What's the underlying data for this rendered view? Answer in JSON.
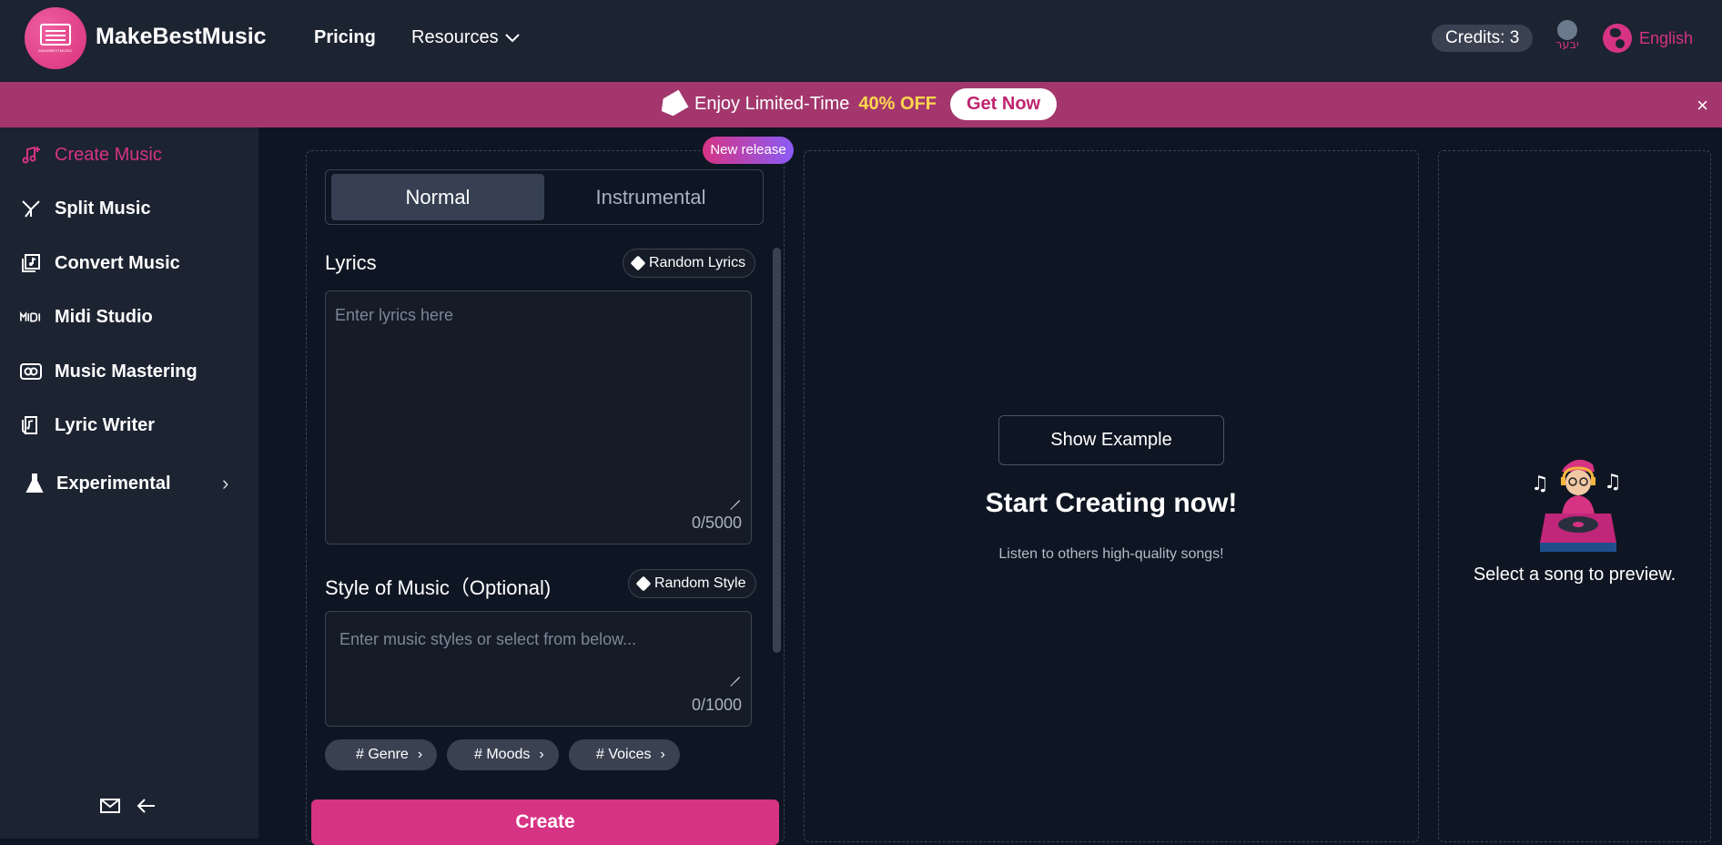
{
  "header": {
    "logo_text": "MAKEBESTMUSIC",
    "brand": "MakeBestMusic",
    "nav": {
      "pricing": "Pricing",
      "resources": "Resources"
    },
    "credits": "Credits: 3",
    "avatar_alt": "יבער",
    "language": "English"
  },
  "promo": {
    "text": "Enjoy Limited-Time",
    "highlight": "40% OFF",
    "cta": "Get Now",
    "close": "×",
    "icon": "tag-icon"
  },
  "sidebar": {
    "items": [
      {
        "label": "Create Music",
        "icon": "music-plus-icon",
        "active": true
      },
      {
        "label": "Split Music",
        "icon": "split-icon"
      },
      {
        "label": "Convert Music",
        "icon": "convert-icon"
      },
      {
        "label": "Midi Studio",
        "icon": "midi-icon"
      },
      {
        "label": "Music Mastering",
        "icon": "mastering-icon"
      },
      {
        "label": "Lyric Writer",
        "icon": "lyric-icon"
      },
      {
        "label": "Experimental",
        "icon": "flask-icon"
      }
    ],
    "bottom_icons": [
      "mail-icon",
      "arrow-left-icon"
    ]
  },
  "create_panel": {
    "badge": "New release",
    "tabs": [
      "Normal",
      "Instrumental"
    ],
    "lyrics": {
      "title": "Lyrics",
      "random_button": "Random Lyrics",
      "placeholder": "Enter lyrics here",
      "counter": "0/5000"
    },
    "style": {
      "title": "Style of Music（Optional)",
      "random_button": "Random Style",
      "placeholder": "Enter music styles or select from below...",
      "counter": "0/1000"
    },
    "chips": [
      "# Genre",
      "# Moods",
      "# Voices"
    ],
    "create_button": "Create"
  },
  "center_panel": {
    "show_example": "Show Example",
    "title": "Start Creating now!",
    "subtitle": "Listen to others high-quality songs!"
  },
  "preview_panel": {
    "text": "Select a song to preview."
  },
  "colors": {
    "accent": "#d63384",
    "promo_bg": "#a3376d",
    "highlight": "#ffd84d",
    "background": "#0f1623",
    "panel": "#1c2331"
  }
}
